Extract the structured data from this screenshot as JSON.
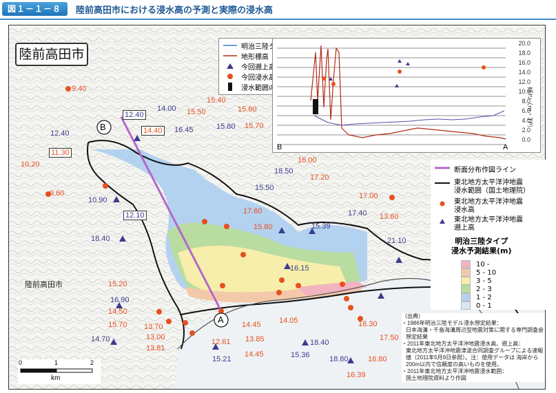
{
  "header": {
    "figure_number": "図１－１－８",
    "title": "陸前高田市における浸水高の予測と実際の浸水高"
  },
  "map": {
    "city_title": "陸前高田市",
    "place_name": "陸前高田市",
    "point_a": "A",
    "point_b": "B",
    "orange_labels": [
      "9.40",
      "10.20",
      "9.60",
      "11.30",
      "15.40",
      "15.60",
      "15.70",
      "15.50",
      "14.40",
      "16.00",
      "17.20",
      "17.60",
      "15.80",
      "17.00",
      "13.60",
      "15.20",
      "14.50",
      "15.70",
      "13.70",
      "13.00",
      "13.81",
      "12.61",
      "14.45",
      "13.85",
      "14.45",
      "14.05",
      "18.30",
      "17.50",
      "16.80",
      "16.39"
    ],
    "purple_labels": [
      "12.40",
      "14.00",
      "12.40",
      "10.90",
      "16.45",
      "15.80",
      "18.50",
      "15.50",
      "12.10",
      "18.40",
      "15.39",
      "17.40",
      "21.10",
      "16.15",
      "16.90",
      "14.70",
      "15.21",
      "15.36",
      "18.40",
      "18.80"
    ],
    "boxed_labels": [
      "12.40",
      "14.40",
      "11.30",
      "12.10",
      "15.40"
    ]
  },
  "legend_top": {
    "items": [
      {
        "label": "明治三陸タイプ",
        "color": "#3a7cd6"
      },
      {
        "label": "地形標高",
        "color": "#b22a14"
      },
      {
        "label": "今回遡上高",
        "color": "#3c3c8c"
      },
      {
        "label": "今回浸水高",
        "color": "#e6501e"
      },
      {
        "label": "浸水範囲の境界",
        "color": "#111111"
      }
    ]
  },
  "profile": {
    "y_ticks": [
      "20.0",
      "18.0",
      "16.0",
      "14.0",
      "12.0",
      "10.0",
      "8.0",
      "6.0",
      "4.0",
      "2.0",
      "0.0"
    ],
    "y_name": "高さ（m・TP）",
    "x_left": "B",
    "x_right": "A"
  },
  "legend_right": {
    "line_label": "断面分布作図ライン",
    "boundary_label": "東北地方太平洋沖地震\n浸水範囲（国土地理院）",
    "dot_label": "東北地方太平洋沖地震\n浸水高",
    "triangle_label": "東北地方太平洋沖地震\n遡上高",
    "scale_title": "明治三陸タイプ\n浸水予測結果(m)",
    "scale": [
      {
        "label": "10 -",
        "color": "#f3b3bf"
      },
      {
        "label": "5 - 10",
        "color": "#f4c9a9"
      },
      {
        "label": "3 - 5",
        "color": "#f6eeaa"
      },
      {
        "label": "2 - 3",
        "color": "#b9dca0"
      },
      {
        "label": "1 - 2",
        "color": "#b3d2ef"
      },
      {
        "label": "0 - 1",
        "color": "#d7e7f5"
      }
    ]
  },
  "source": {
    "lines": [
      "（出典）",
      "・1986年明治三陸モデル浸水想定結果：",
      "日本海溝・千島海溝周辺型地震対策に関する専門調査会想定結果",
      "・2011年東北地方太平洋沖地震浸水高、遡上高：",
      "東北地方太平洋沖地震津波合同調査グループによる速報値（2011年5月9日参照）。注：使用データは 海岸から200m以内で信頼度の高いものを使用。",
      "・2011年東北地方太平洋沖地震浸水範囲：",
      "国土地理院資料より作図"
    ]
  },
  "scalebar": {
    "ticks": [
      "0",
      "1",
      "2"
    ],
    "unit": "km"
  }
}
